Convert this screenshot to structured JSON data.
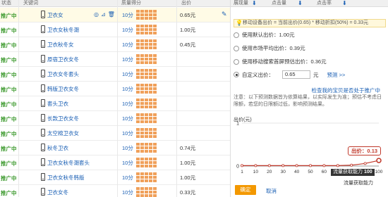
{
  "table": {
    "headers": {
      "status": "状态",
      "keyword": "关键词",
      "quality": "质量得分",
      "bid": "出价"
    },
    "rows": [
      {
        "status": "推广中",
        "keyword": "卫衣女",
        "score": "10分",
        "price": "0.65元",
        "highlight": true
      },
      {
        "status": "推广中",
        "keyword": "卫衣女秋冬潮",
        "score": "10分",
        "price": "1.00元"
      },
      {
        "status": "推广中",
        "keyword": "卫衣秋冬女",
        "score": "10分",
        "price": "0.45元"
      },
      {
        "status": "推广中",
        "keyword": "原宿卫衣女冬",
        "score": "10分",
        "price": ""
      },
      {
        "status": "推广中",
        "keyword": "卫衣女冬套头",
        "score": "10分",
        "price": ""
      },
      {
        "status": "推广中",
        "keyword": "韩版卫衣女冬",
        "score": "10分",
        "price": ""
      },
      {
        "status": "推广中",
        "keyword": "套头卫衣",
        "score": "10分",
        "price": ""
      },
      {
        "status": "推广中",
        "keyword": "长款卫衣女冬",
        "score": "10分",
        "price": ""
      },
      {
        "status": "推广中",
        "keyword": "太空棉卫衣女",
        "score": "10分",
        "price": ""
      },
      {
        "status": "推广中",
        "keyword": "秋冬卫衣",
        "score": "10分",
        "price": "0.74元"
      },
      {
        "status": "推广中",
        "keyword": "卫衣女秋冬潮套头",
        "score": "10分",
        "price": "1.00元"
      },
      {
        "status": "推广中",
        "keyword": "卫衣女秋冬韩版",
        "score": "10分",
        "price": "1.00元"
      },
      {
        "status": "推广中",
        "keyword": "卫衣女冬",
        "score": "10分",
        "price": "0.33元"
      }
    ],
    "icons": [
      "target-icon",
      "chart-icon",
      "trash-icon",
      "pencil-icon"
    ]
  },
  "panel": {
    "headers": {
      "impressions": "展现量",
      "clicks": "点击量",
      "ctr": "点击率"
    },
    "tip": "移动设备出价 = 当前出价(0.65) * 移动折扣(50%) = 0.33元",
    "options": [
      {
        "label": "使用默认出价：1.00元",
        "checked": false
      },
      {
        "label": "使用市场平均出价：0.39元",
        "checked": false
      },
      {
        "label": "使用移动搜索首屏预估出价：0.36元",
        "checked": false
      },
      {
        "label": "自定义出价：",
        "checked": true
      }
    ],
    "custom_value": "0.65",
    "unit": "元",
    "preview": "预测 >>",
    "check_link": "检查我的宝贝是否处于推广中",
    "note": "注意：以下预测数据皆为依算结果，以实际发生为准；预估不考虑日限额，若您的日限额过低，影响预测结果。",
    "ylabel": "出价(元)",
    "callout": "出价：0.13",
    "tag_prefix": "流量获取能力",
    "tag_value": "100",
    "xlabel": "流量获取能力",
    "confirm": "确定",
    "cancel": "取消"
  },
  "chart_data": {
    "type": "line",
    "ylabel": "出价(元)",
    "xlabel": "流量获取能力",
    "x": [
      1,
      10,
      20,
      30,
      40,
      50,
      60,
      70,
      80,
      90,
      100
    ],
    "y": [
      0.01,
      0.01,
      0.01,
      0.01,
      0.01,
      0.01,
      0.01,
      0.01,
      0.02,
      0.06,
      0.13
    ],
    "yticks": [
      0,
      1
    ],
    "xticks": [
      "1",
      "10",
      "20",
      "30",
      "40",
      "50",
      "60",
      "70",
      "80",
      "90",
      "100"
    ],
    "ylim": [
      0,
      1.05
    ],
    "xlim": [
      1,
      100
    ],
    "colors": {
      "line": "#c0392b",
      "point": "#ffffff",
      "grid": "#e6e6e6"
    },
    "grid": true,
    "highlight": {
      "x": 100,
      "y": 0.13
    }
  }
}
